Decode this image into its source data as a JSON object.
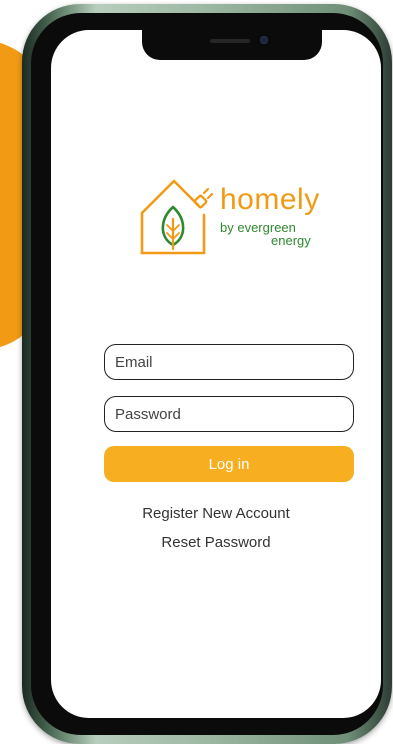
{
  "brand": {
    "name": "homely",
    "tagline_line1": "by evergreen",
    "tagline_line2": "energy",
    "primary_color": "#f39a15",
    "secondary_color": "#2f8a2f"
  },
  "login_form": {
    "email_placeholder": "Email",
    "email_value": "",
    "password_placeholder": "Password",
    "password_value": "",
    "login_label": "Log in",
    "button_color": "#f7ae20"
  },
  "links": {
    "register": "Register New Account",
    "reset": "Reset Password"
  },
  "icons": {
    "logo": "house-leaf-plug-icon",
    "camera": "front-camera-icon"
  }
}
